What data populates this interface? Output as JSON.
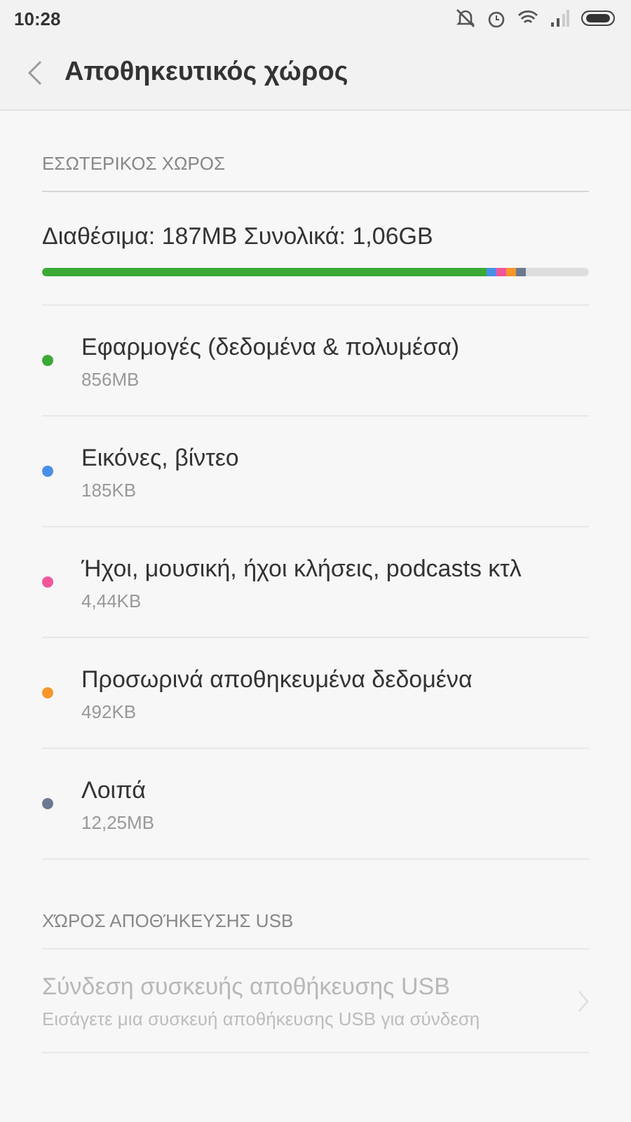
{
  "status_bar": {
    "time": "10:28"
  },
  "header": {
    "title": "Αποθηκευτικός χώρος"
  },
  "internal": {
    "heading": "ΕΣΩΤΕΡΙΚΟΣ ΧΩΡΟΣ",
    "summary": "Διαθέσιμα: 187MB  Συνολικά: 1,06GB",
    "categories": [
      {
        "name": "Εφαρμογές (δεδομένα & πολυμέσα)",
        "size": "856MB",
        "color": "#3aaa35",
        "level": 0.813
      },
      {
        "name": "Εικόνες, βίντεο",
        "size": "185KB",
        "color": "#4a8fe7"
      },
      {
        "name": "Ήχοι, μουσική, ήχοι κλήσεις, podcasts κτλ",
        "size": "4,44KB",
        "color": "#f2559a"
      },
      {
        "name": "Προσωρινά αποθηκευμένα δεδομένα",
        "size": "492KB",
        "color": "#f7962a"
      },
      {
        "name": "Λοιπά",
        "size": "12,25MB",
        "color": "#6b7a91"
      }
    ]
  },
  "usb": {
    "heading": "ΧΏΡΟΣ ΑΠΟΘΉΚΕΥΣΗΣ USB",
    "item": {
      "title": "Σύνδεση συσκευής αποθήκευσης USB",
      "subtitle": "Εισάγετε μια συσκευή αποθήκευσης USB για σύνδεση",
      "disabled": true
    }
  }
}
